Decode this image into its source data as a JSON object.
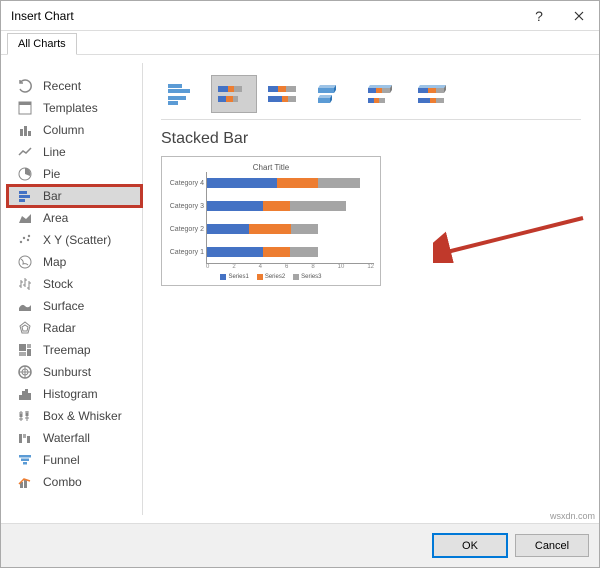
{
  "dialog": {
    "title": "Insert Chart"
  },
  "tabs": {
    "all_charts": "All Charts"
  },
  "sidebar": {
    "items": [
      {
        "label": "Recent"
      },
      {
        "label": "Templates"
      },
      {
        "label": "Column"
      },
      {
        "label": "Line"
      },
      {
        "label": "Pie"
      },
      {
        "label": "Bar"
      },
      {
        "label": "Area"
      },
      {
        "label": "X Y (Scatter)"
      },
      {
        "label": "Map"
      },
      {
        "label": "Stock"
      },
      {
        "label": "Surface"
      },
      {
        "label": "Radar"
      },
      {
        "label": "Treemap"
      },
      {
        "label": "Sunburst"
      },
      {
        "label": "Histogram"
      },
      {
        "label": "Box & Whisker"
      },
      {
        "label": "Waterfall"
      },
      {
        "label": "Funnel"
      },
      {
        "label": "Combo"
      }
    ]
  },
  "main": {
    "section_title": "Stacked Bar"
  },
  "chart_data": {
    "type": "bar",
    "orientation": "horizontal",
    "stacked": true,
    "title": "Chart Title",
    "categories": [
      "Category 1",
      "Category 2",
      "Category 3",
      "Category 4"
    ],
    "series": [
      {
        "name": "Series1",
        "values": [
          4,
          3,
          4,
          5
        ]
      },
      {
        "name": "Series2",
        "values": [
          2,
          3,
          2,
          3
        ]
      },
      {
        "name": "Series3",
        "values": [
          2,
          2,
          4,
          3
        ]
      }
    ],
    "x_ticks": [
      0,
      2,
      4,
      6,
      8,
      10,
      12
    ],
    "xlim": [
      0,
      12
    ]
  },
  "buttons": {
    "ok": "OK",
    "cancel": "Cancel"
  },
  "watermark": "wsxdn.com"
}
